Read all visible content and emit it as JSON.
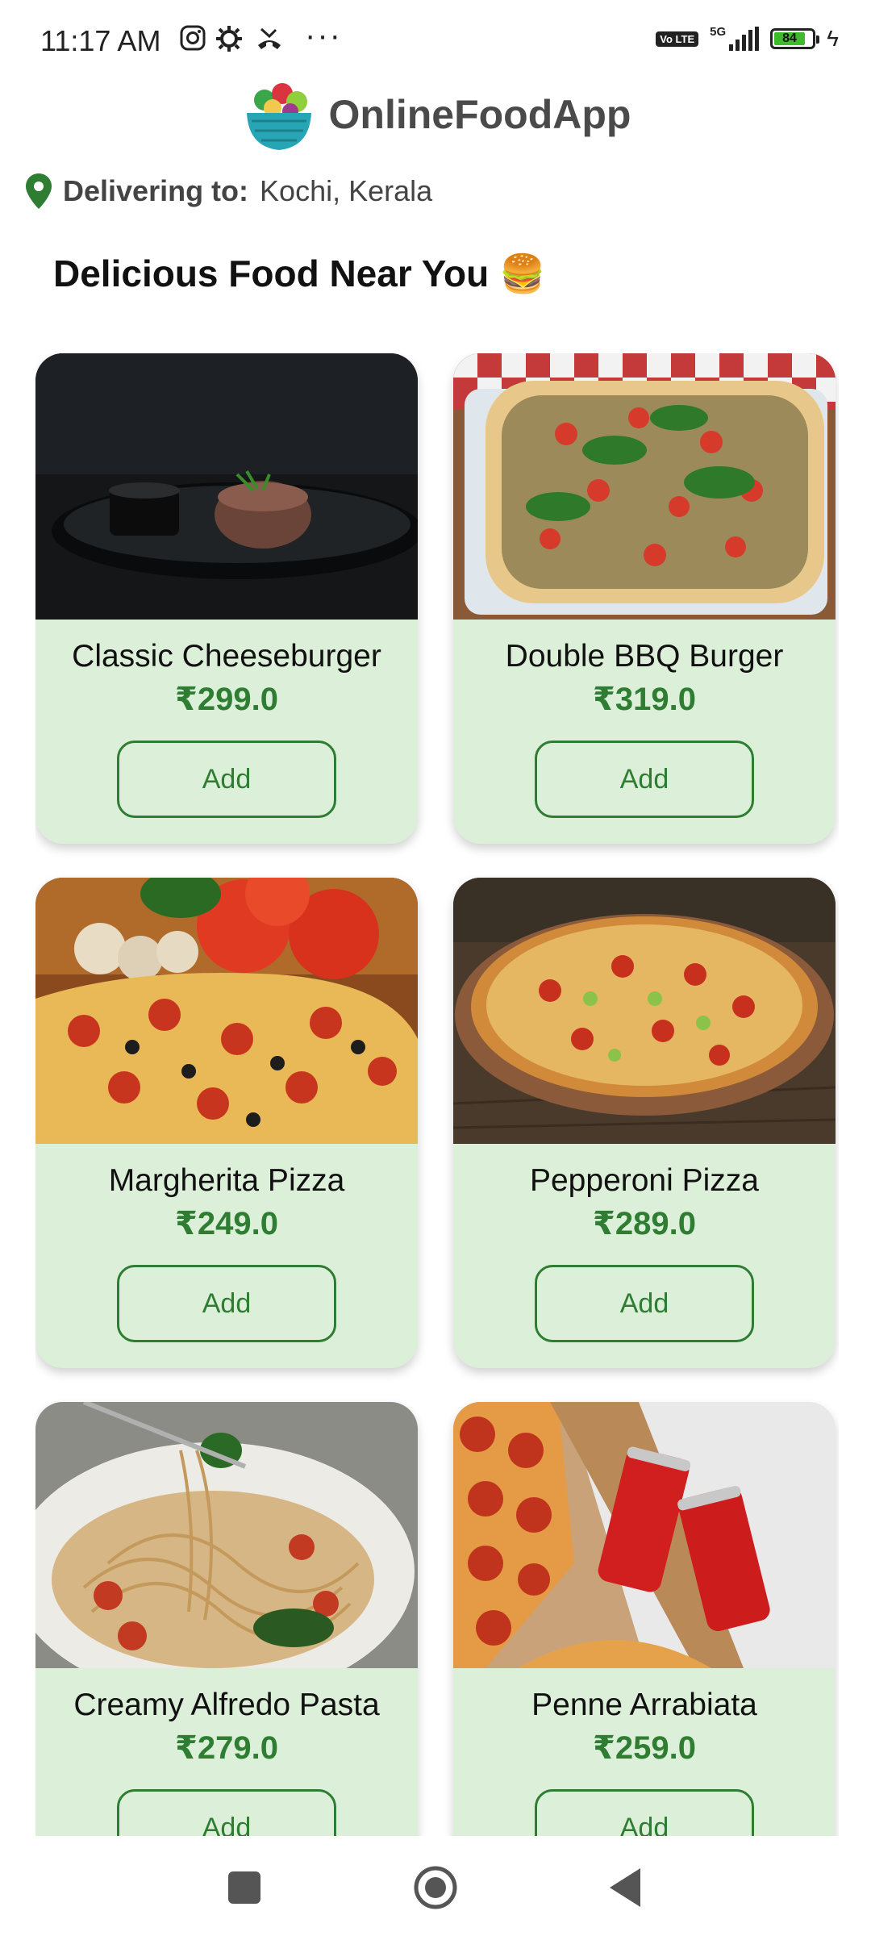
{
  "status_bar": {
    "time": "11:17 AM",
    "network": "5G",
    "volte": "Vo LTE",
    "battery": "84",
    "icons": [
      "instagram-icon",
      "settings-icon",
      "missed-call-icon",
      "more-icon"
    ]
  },
  "header": {
    "title": "OnlineFoodApp"
  },
  "delivery": {
    "label": "Delivering to:",
    "city": "Kochi, Kerala"
  },
  "section": {
    "title": "Delicious Food Near You 🍔"
  },
  "items": [
    {
      "name": "Classic Cheeseburger",
      "price": "₹299.0",
      "button": "Add"
    },
    {
      "name": "Double BBQ Burger",
      "price": "₹319.0",
      "button": "Add"
    },
    {
      "name": "Margherita Pizza",
      "price": "₹249.0",
      "button": "Add"
    },
    {
      "name": "Pepperoni Pizza",
      "price": "₹289.0",
      "button": "Add"
    },
    {
      "name": "Creamy Alfredo Pasta",
      "price": "₹279.0",
      "button": "Add"
    },
    {
      "name": "Penne Arrabiata",
      "price": "₹259.0",
      "button": "Add"
    }
  ],
  "colors": {
    "accent": "#2e7d32",
    "card_bg": "#dcefd8"
  }
}
